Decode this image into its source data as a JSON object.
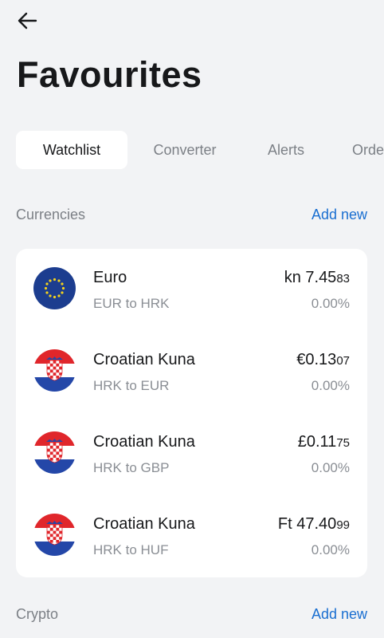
{
  "header": {
    "back_icon": "arrow-left-icon",
    "title": "Favourites"
  },
  "tabs": [
    {
      "label": "Watchlist",
      "active": true
    },
    {
      "label": "Converter",
      "active": false
    },
    {
      "label": "Alerts",
      "active": false
    },
    {
      "label": "Orde",
      "active": false
    }
  ],
  "currencies": {
    "title": "Currencies",
    "add_label": "Add new",
    "items": [
      {
        "name": "Euro",
        "pair": "EUR to HRK",
        "price_main": "kn 7.45",
        "price_minor": "83",
        "change": "0.00%",
        "flag": "eu-flag-icon"
      },
      {
        "name": "Croatian Kuna",
        "pair": "HRK to EUR",
        "price_main": "€0.13",
        "price_minor": "07",
        "change": "0.00%",
        "flag": "croatia-flag-icon"
      },
      {
        "name": "Croatian Kuna",
        "pair": "HRK to GBP",
        "price_main": "£0.11",
        "price_minor": "75",
        "change": "0.00%",
        "flag": "croatia-flag-icon"
      },
      {
        "name": "Croatian Kuna",
        "pair": "HRK to HUF",
        "price_main": "Ft 47.40",
        "price_minor": "99",
        "change": "0.00%",
        "flag": "croatia-flag-icon"
      }
    ]
  },
  "crypto": {
    "title": "Crypto",
    "add_label": "Add new"
  },
  "colors": {
    "background": "#f2f3f5",
    "accent": "#1a6fd1",
    "eu_blue": "#1c3d8f",
    "eu_gold": "#f5d31a",
    "hr_red": "#e0262b",
    "hr_blue": "#2447a8"
  }
}
